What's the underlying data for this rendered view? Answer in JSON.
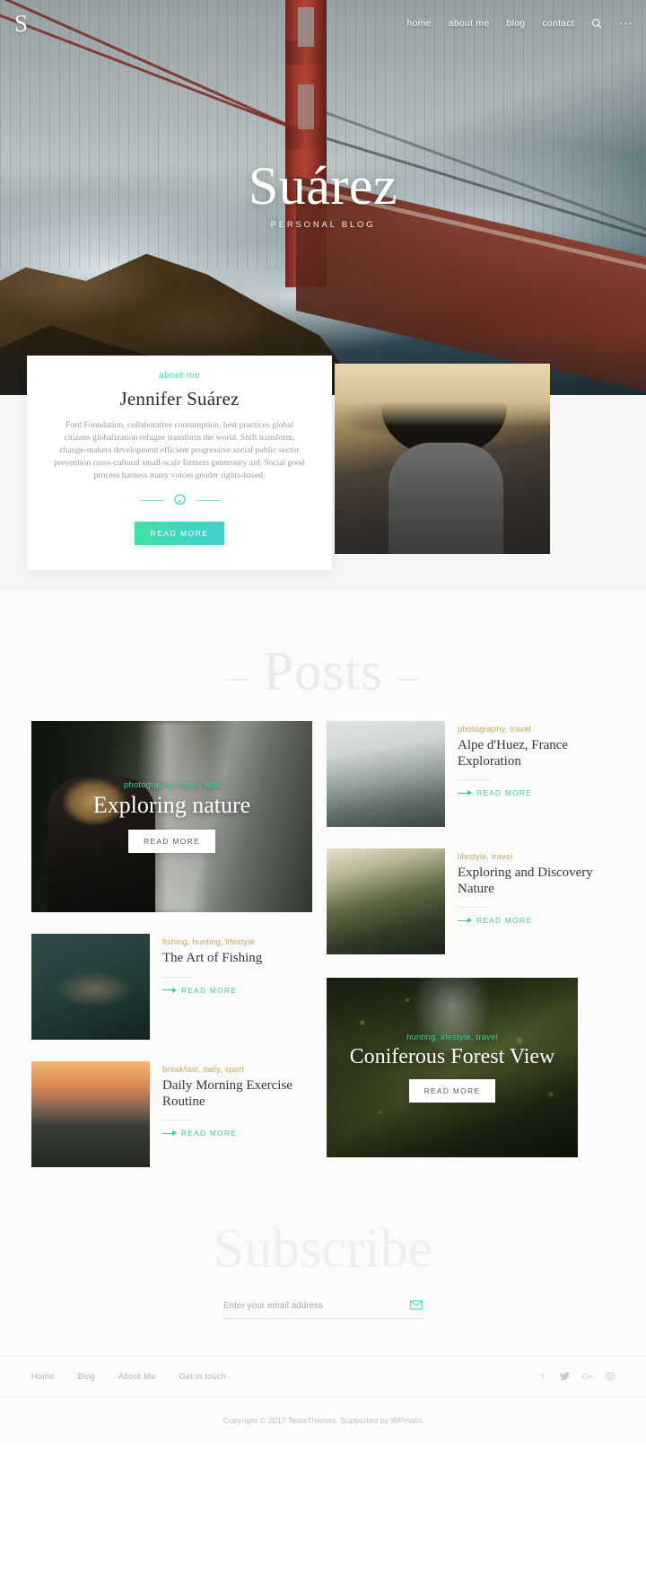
{
  "nav": {
    "logo": "S",
    "links": [
      {
        "label": "home"
      },
      {
        "label": "about me"
      },
      {
        "label": "blog"
      },
      {
        "label": "contact"
      }
    ],
    "search_icon": "search-icon",
    "more_icon": "···"
  },
  "hero": {
    "title": "Suárez",
    "subtitle": "PERSONAL BLOG"
  },
  "about": {
    "kicker": "about me",
    "name": "Jennifer Suárez",
    "text": "Ford Foundation, collaborative consumption, best practices global citizens globalization refugee transform the world. Shift transform, change-makers development efficient progressive social public sector prevention cross-cultural small-scale farmers generosity aid. Social good process harness many voices gender rights-based.",
    "button": "READ MORE",
    "accent": "#3ddbb8",
    "button_gradient_from": "#3fe0a6",
    "button_gradient_to": "#41cfd0"
  },
  "posts": {
    "section_title": "Posts",
    "featured_main": {
      "categories": "photography, travel, wild",
      "title": "Exploring nature",
      "button": "READ MORE"
    },
    "featured_secondary": {
      "categories": "hunting, lifestyle, travel",
      "title": "Coniferous Forest View",
      "button": "READ MORE"
    },
    "cards": [
      {
        "categories": "photography, travel",
        "title": "Alpe d'Huez, France Exploration",
        "read_more": "READ MORE"
      },
      {
        "categories": "lifestyle, travel",
        "title": "Exploring and Discovery Nature",
        "read_more": "READ MORE"
      },
      {
        "categories": "fishing, hunting, lifestyle",
        "title": "The Art of Fishing",
        "read_more": "READ MORE"
      },
      {
        "categories": "breakfast, daily, sport",
        "title": "Daily Morning Exercise Routine",
        "read_more": "READ MORE"
      }
    ],
    "category_gold": "#c9a961",
    "category_green": "#35d9a0",
    "readmore_color": "#3fc9a8"
  },
  "subscribe": {
    "title": "Subscribe",
    "placeholder": "Enter your email address",
    "value": "",
    "submit_icon": "envelope-icon"
  },
  "footer": {
    "links": [
      {
        "label": "Home"
      },
      {
        "label": "Blog"
      },
      {
        "label": "About Me"
      },
      {
        "label": "Get in touch"
      }
    ],
    "social": [
      {
        "name": "facebook-icon",
        "glyph": "f"
      },
      {
        "name": "twitter-icon",
        "glyph": "❧"
      },
      {
        "name": "google-plus-icon",
        "glyph": "G+"
      },
      {
        "name": "instagram-icon",
        "glyph": "□"
      }
    ],
    "copyright": "Copyright © 2017 TeslaThemes, Supported by WPmatic"
  }
}
